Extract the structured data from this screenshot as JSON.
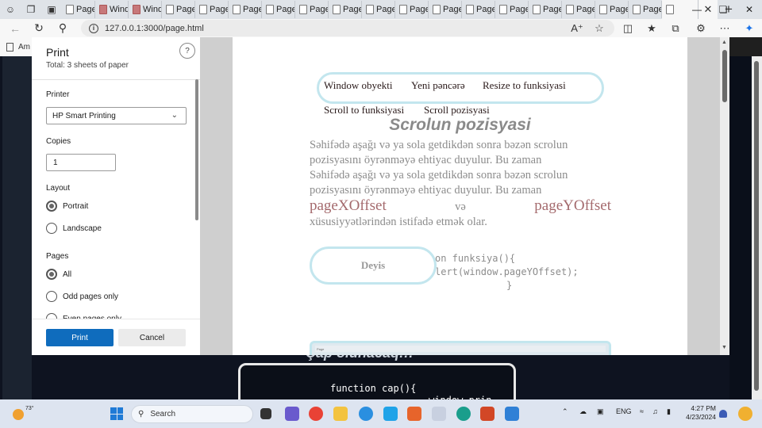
{
  "browser": {
    "tabs": [
      {
        "label": "Page",
        "kind": "page"
      },
      {
        "label": "Wind",
        "kind": "red"
      },
      {
        "label": "Wind",
        "kind": "red"
      },
      {
        "label": "Page",
        "kind": "page"
      },
      {
        "label": "Page",
        "kind": "page"
      },
      {
        "label": "Page",
        "kind": "page"
      },
      {
        "label": "Page",
        "kind": "page"
      },
      {
        "label": "Page",
        "kind": "page"
      },
      {
        "label": "Page",
        "kind": "page"
      },
      {
        "label": "Page",
        "kind": "page"
      },
      {
        "label": "Page",
        "kind": "page"
      },
      {
        "label": "Page",
        "kind": "page"
      },
      {
        "label": "Page",
        "kind": "page"
      },
      {
        "label": "Page",
        "kind": "page"
      },
      {
        "label": "Page",
        "kind": "page"
      },
      {
        "label": "Page",
        "kind": "page"
      },
      {
        "label": "Page",
        "kind": "page"
      },
      {
        "label": "Page",
        "kind": "page"
      }
    ],
    "active_tab_label": "Page",
    "url": "127.0.0.1:3000/page.html",
    "bookmark_label": "Am"
  },
  "print_dialog": {
    "title": "Print",
    "total": "Total: 3 sheets of paper",
    "help": "?",
    "printer_label": "Printer",
    "printer_value": "HP Smart Printing",
    "copies_label": "Copies",
    "copies_value": "1",
    "layout_label": "Layout",
    "layout_options": [
      {
        "label": "Portrait",
        "checked": true
      },
      {
        "label": "Landscape",
        "checked": false
      }
    ],
    "pages_label": "Pages",
    "pages_options": [
      {
        "label": "All",
        "checked": true
      },
      {
        "label": "Odd pages only",
        "checked": false
      },
      {
        "label": "Even pages only",
        "checked": false
      }
    ],
    "print_button": "Print",
    "cancel_button": "Cancel"
  },
  "preview": {
    "nav_links": [
      "Window obyekti",
      "Yeni pəncərə",
      "Resize to funksiyasi",
      "Scroll to funksiyasi",
      "Scroll pozisyasi"
    ],
    "heading": "Scrolun pozisyasi",
    "paragraph_lines": [
      "Səhifədə aşağı və ya sola getdikdən sonra bəzən scrolun",
      "pozisyasını öyrənməyə ehtiyac duyulur. Bu zaman",
      "Səhifədə aşağı və ya sola getdikdən sonra bəzən scrolun",
      "pozisyasını öyrənməyə ehtiyac duyulur. Bu zaman"
    ],
    "prop_x": "pageXOffset",
    "prop_and": "və",
    "prop_y": "pageYOffset",
    "paragraph_tail": "xüsusiyyətlərindən istifadə etmək olar.",
    "button": "Deyis",
    "code_lines": [
      "on funksiya(){",
      "lert(window.pageYOffset);",
      "}"
    ],
    "mini_tab": "Page"
  },
  "background_page": {
    "heading_fragment": "Çap olunacaq!!!",
    "code": "function cap(){",
    "code2": "window.print();"
  },
  "taskbar": {
    "temperature": "73°",
    "search_placeholder": "Search",
    "language": "ENG",
    "time": "4:27 PM",
    "date": "4/23/2024"
  },
  "colors": {
    "print_button": "#0f6cbd",
    "pill_border": "#c3e6ee",
    "property_text": "#a46a6d",
    "dark_page": "#0e1320"
  }
}
